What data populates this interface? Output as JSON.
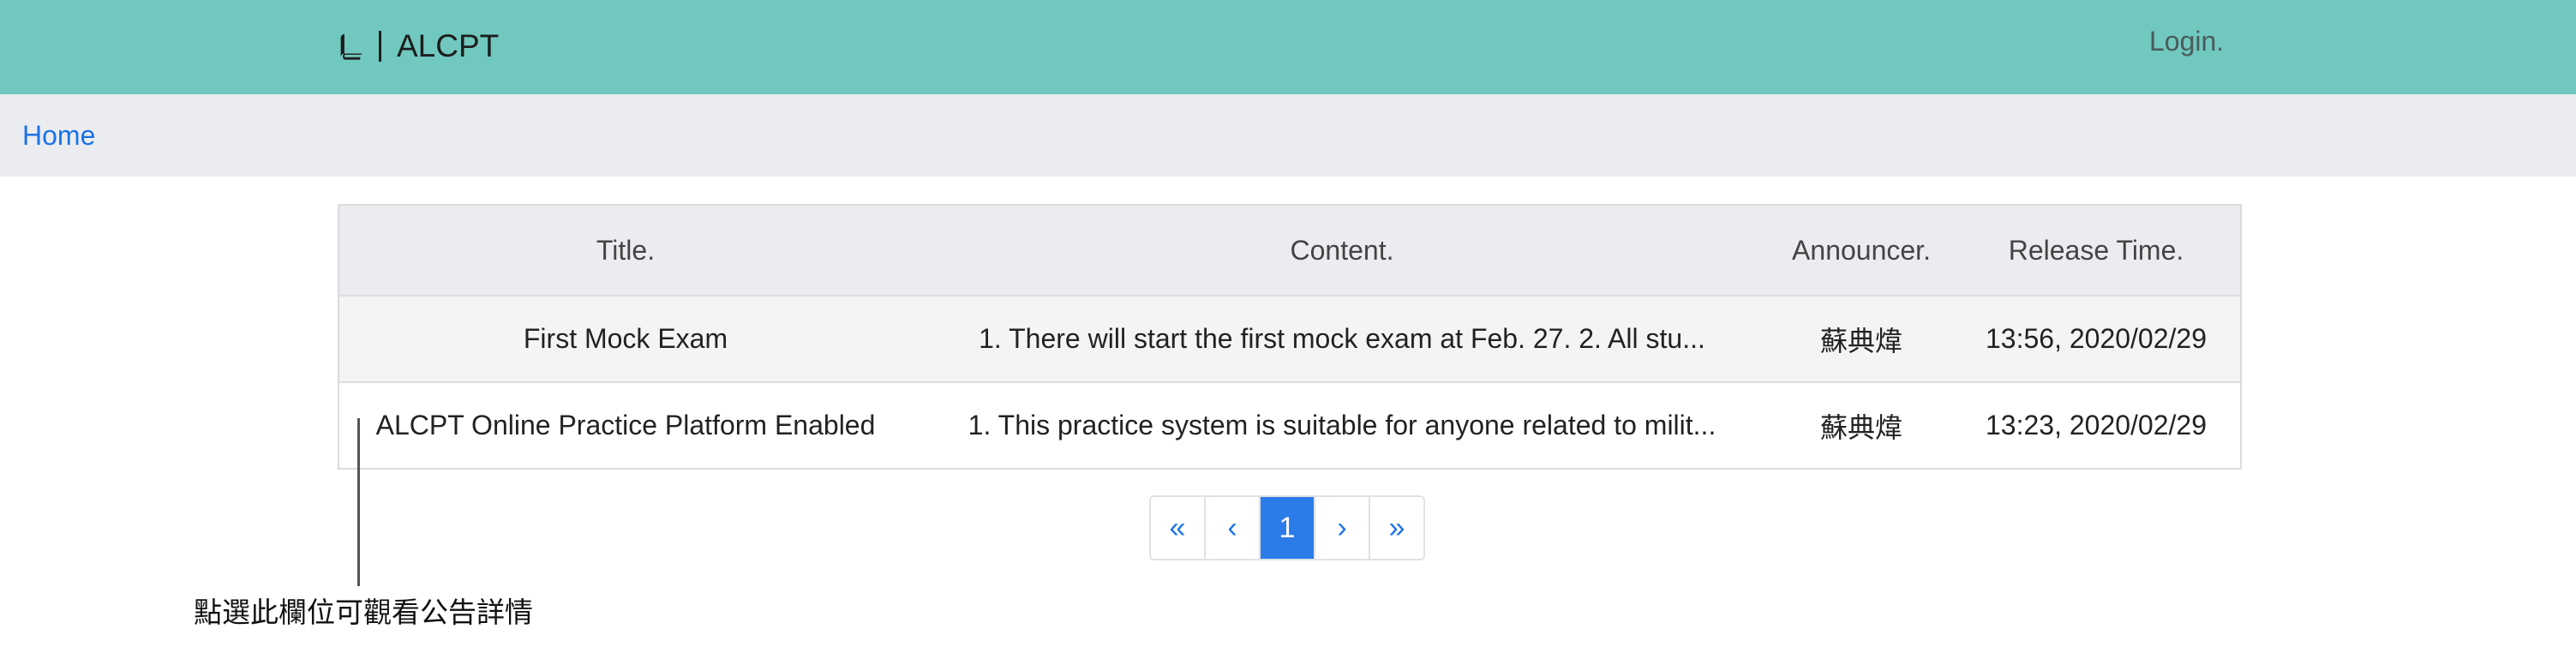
{
  "navbar": {
    "brand": "ALCPT",
    "login": "Login.",
    "color": "#70c8bf"
  },
  "breadcrumb": {
    "home": "Home"
  },
  "table": {
    "headers": {
      "title": "Title.",
      "content": "Content.",
      "announcer": "Announcer.",
      "release_time": "Release Time."
    },
    "rows": [
      {
        "title": "First Mock Exam",
        "content": "1. There will start the first mock exam at Feb. 27. 2. All stu...",
        "announcer": "蘇典煒",
        "release_time": "13:56, 2020/02/29"
      },
      {
        "title": "ALCPT Online Practice Platform Enabled",
        "content": "1. This practice system is suitable for anyone related to milit...",
        "announcer": "蘇典煒",
        "release_time": "13:23, 2020/02/29"
      }
    ]
  },
  "pagination": {
    "first": "«",
    "prev": "‹",
    "current": "1",
    "next": "›",
    "last": "»"
  },
  "annotation": {
    "text": "點選此欄位可觀看公告詳情"
  },
  "icons": {
    "brand_icon": "book-icon"
  }
}
